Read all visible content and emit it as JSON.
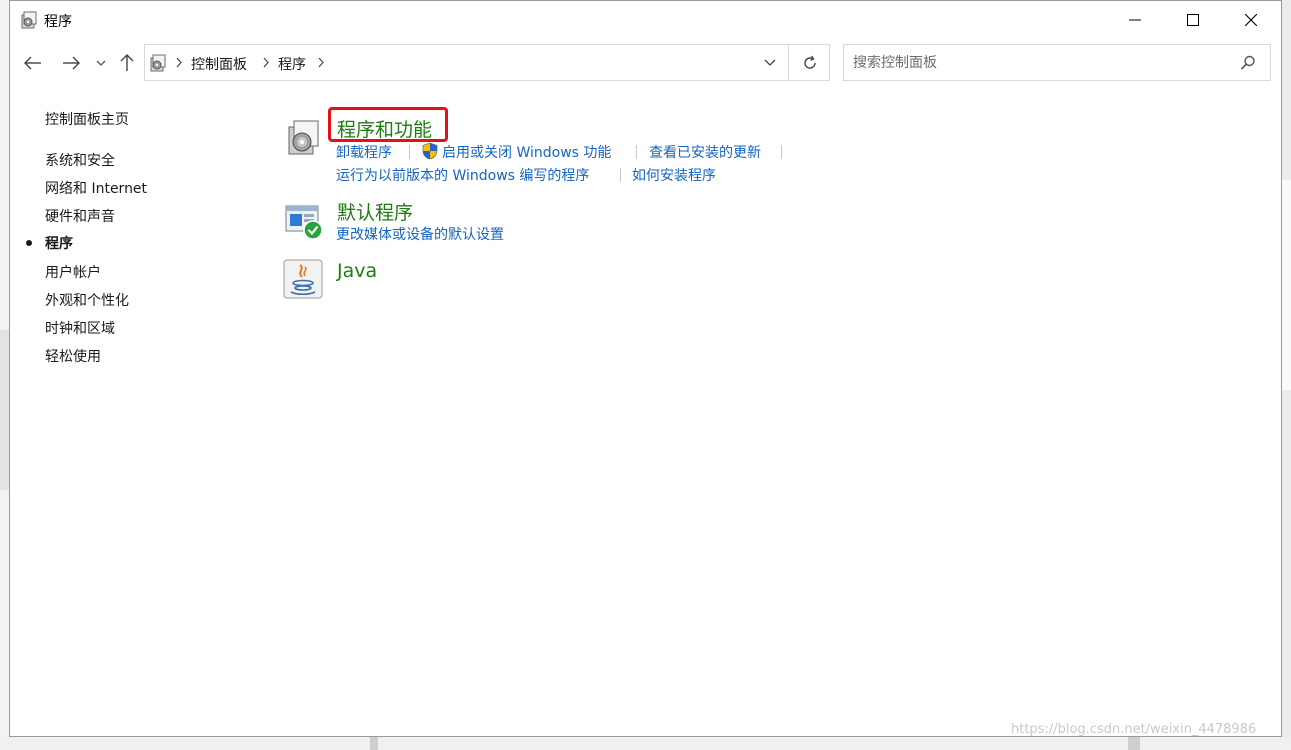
{
  "window": {
    "title": "程序"
  },
  "nav": {
    "breadcrumb": [
      "控制面板",
      "程序"
    ]
  },
  "search": {
    "placeholder": "搜索控制面板"
  },
  "sidebar": {
    "home": "控制面板主页",
    "items": [
      {
        "label": "系统和安全",
        "current": false
      },
      {
        "label": "网络和 Internet",
        "current": false
      },
      {
        "label": "硬件和声音",
        "current": false
      },
      {
        "label": "程序",
        "current": true
      },
      {
        "label": "用户帐户",
        "current": false
      },
      {
        "label": "外观和个性化",
        "current": false
      },
      {
        "label": "时钟和区域",
        "current": false
      },
      {
        "label": "轻松使用",
        "current": false
      }
    ]
  },
  "categories": [
    {
      "title": "程序和功能",
      "highlighted": true,
      "links": [
        "卸载程序",
        "启用或关闭 Windows 功能",
        "查看已安装的更新",
        "运行为以前版本的 Windows 编写的程序",
        "如何安装程序"
      ]
    },
    {
      "title": "默认程序",
      "links": [
        "更改媒体或设备的默认设置"
      ]
    },
    {
      "title": "Java",
      "links": []
    }
  ],
  "colors": {
    "category_title": "#1e7d12",
    "link": "#1565c0",
    "highlight_box": "#e81010"
  },
  "watermark": "https://blog.csdn.net/weixin_4478986"
}
